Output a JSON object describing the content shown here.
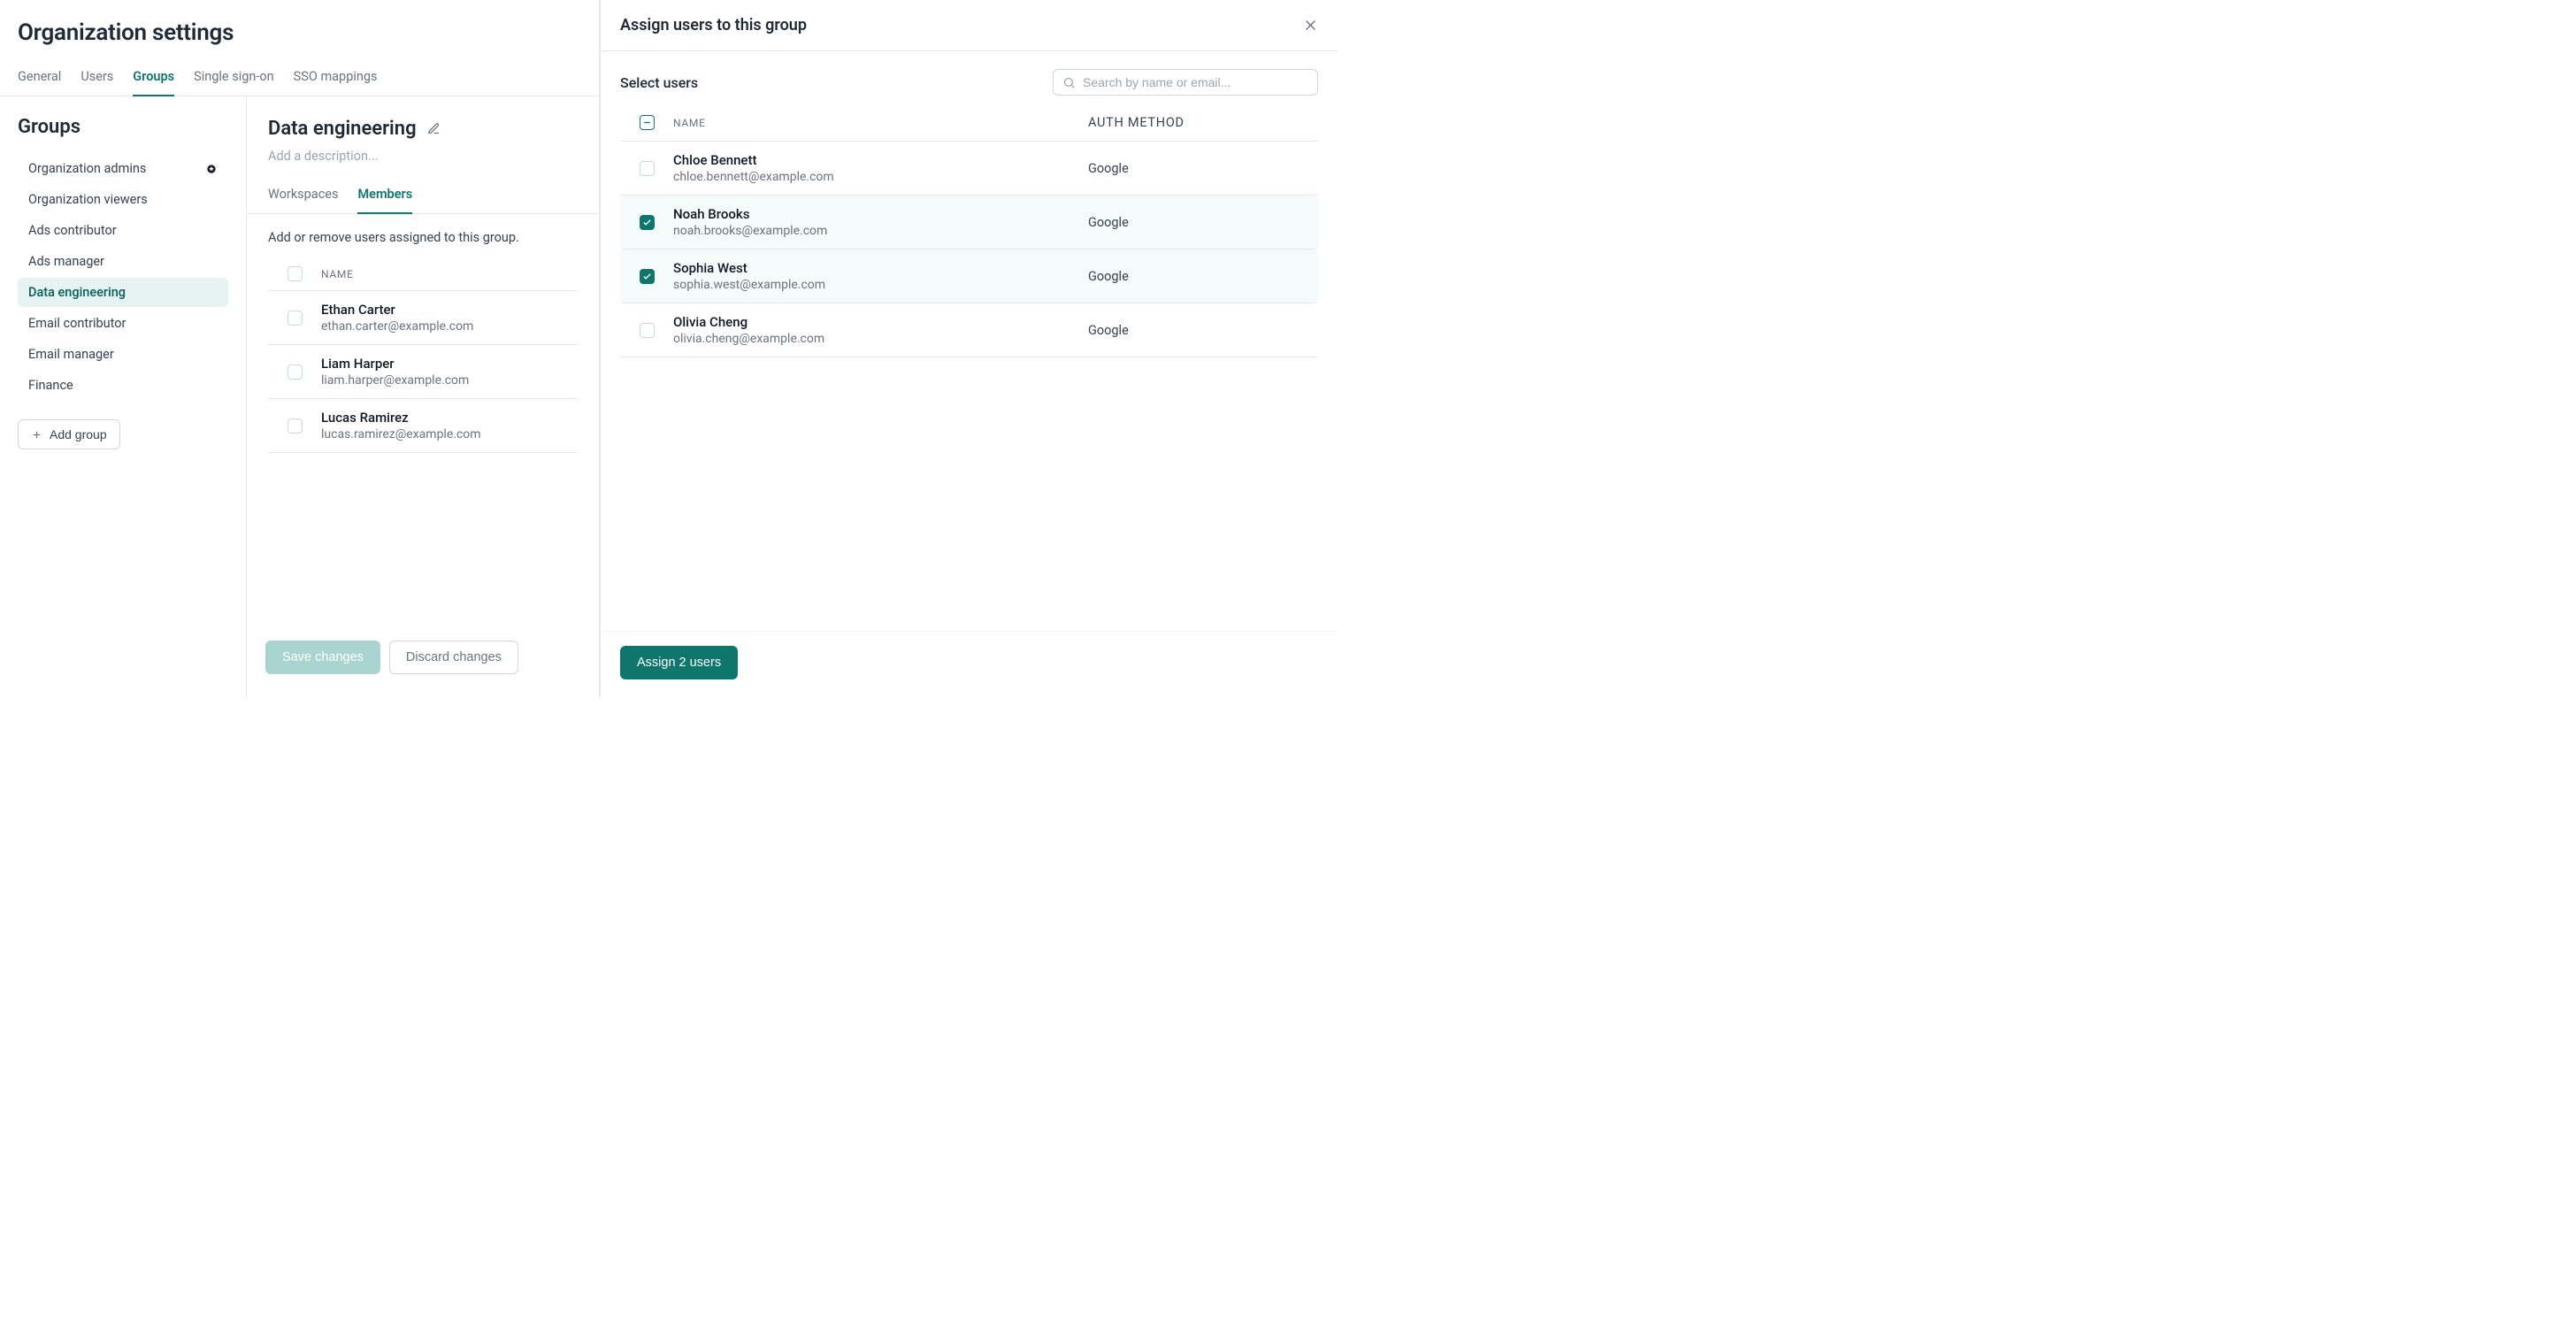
{
  "page": {
    "title": "Organization settings",
    "tabs": [
      {
        "label": "General"
      },
      {
        "label": "Users"
      },
      {
        "label": "Groups",
        "active": true
      },
      {
        "label": "Single sign-on"
      },
      {
        "label": "SSO mappings"
      }
    ]
  },
  "sidebar": {
    "heading": "Groups",
    "items": [
      {
        "label": "Organization admins",
        "badge": true
      },
      {
        "label": "Organization viewers"
      },
      {
        "label": "Ads contributor"
      },
      {
        "label": "Ads manager"
      },
      {
        "label": "Data engineering",
        "active": true
      },
      {
        "label": "Email contributor"
      },
      {
        "label": "Email manager"
      },
      {
        "label": "Finance"
      }
    ],
    "add_group_label": "Add group"
  },
  "detail": {
    "title": "Data engineering",
    "description_placeholder": "Add a description...",
    "subtabs": [
      {
        "label": "Workspaces"
      },
      {
        "label": "Members",
        "active": true
      }
    ],
    "hint": "Add or remove users assigned to this group.",
    "columns": {
      "name": "NAME"
    },
    "members": [
      {
        "name": "Ethan Carter",
        "email": "ethan.carter@example.com",
        "checked": false
      },
      {
        "name": "Liam Harper",
        "email": "liam.harper@example.com",
        "checked": false
      },
      {
        "name": "Lucas Ramirez",
        "email": "lucas.ramirez@example.com",
        "checked": false
      }
    ],
    "footer": {
      "save_label": "Save changes",
      "discard_label": "Discard changes"
    }
  },
  "drawer": {
    "title": "Assign users to this group",
    "select_label": "Select users",
    "search_placeholder": "Search by name or email...",
    "columns": {
      "name": "NAME",
      "auth": "AUTH METHOD"
    },
    "header_checkbox_state": "mixed",
    "users": [
      {
        "name": "Chloe Bennett",
        "email": "chloe.bennett@example.com",
        "auth": "Google",
        "checked": false
      },
      {
        "name": "Noah Brooks",
        "email": "noah.brooks@example.com",
        "auth": "Google",
        "checked": true
      },
      {
        "name": "Sophia West",
        "email": "sophia.west@example.com",
        "auth": "Google",
        "checked": true
      },
      {
        "name": "Olivia Cheng",
        "email": "olivia.cheng@example.com",
        "auth": "Google",
        "checked": false
      }
    ],
    "assign_button_label": "Assign 2 users"
  }
}
